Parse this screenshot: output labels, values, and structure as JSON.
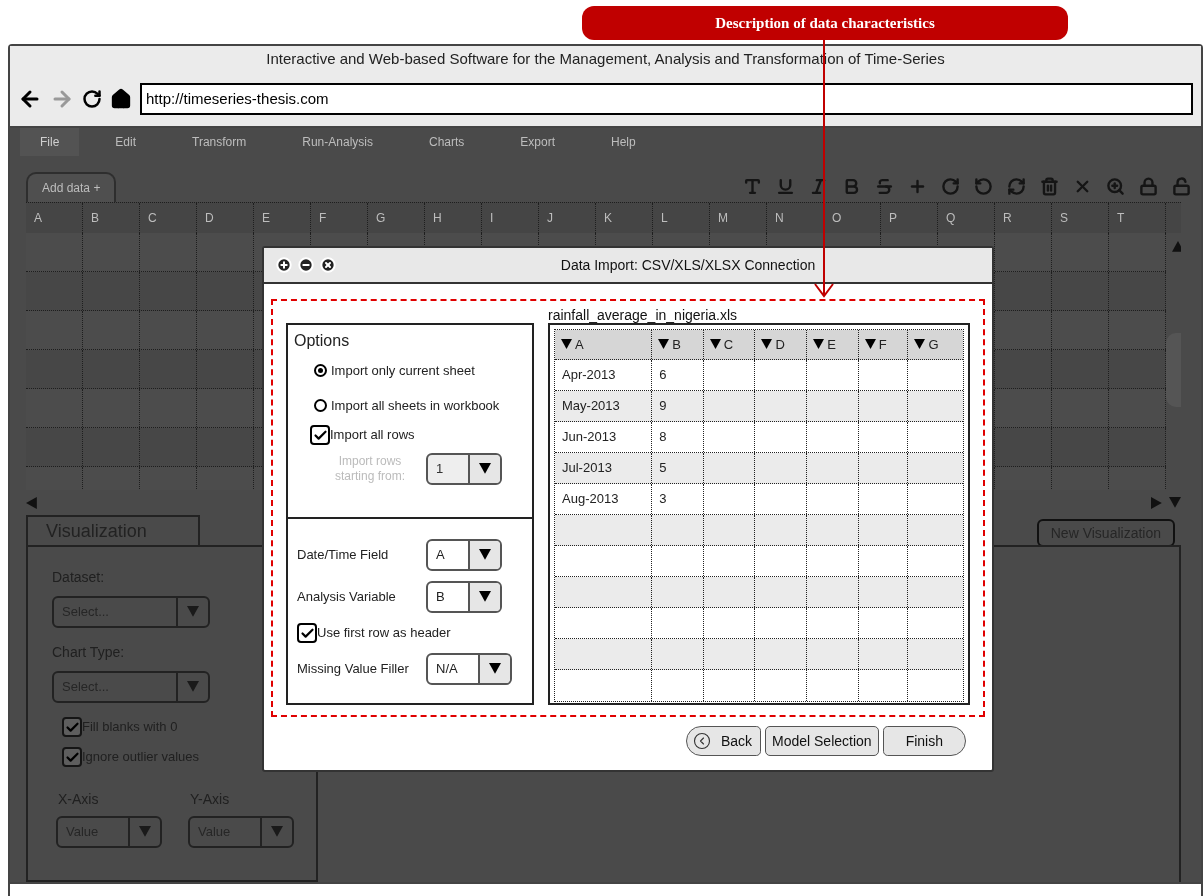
{
  "callout": {
    "text": "Description of data characteristics"
  },
  "browser": {
    "title": "Interactive and Web-based Software for the Management, Analysis and Transformation of Time-Series",
    "url": "http://timeseries-thesis.com"
  },
  "menu": [
    {
      "label": "File",
      "selected": true
    },
    {
      "label": "Edit",
      "selected": false
    },
    {
      "label": "Transform",
      "selected": false
    },
    {
      "label": "Run-Analysis",
      "selected": false
    },
    {
      "label": "Charts",
      "selected": false
    },
    {
      "label": "Export",
      "selected": false
    },
    {
      "label": "Help",
      "selected": false
    }
  ],
  "sheet_tab": {
    "label": "Add data +"
  },
  "spreadsheet": {
    "columns": [
      "A",
      "B",
      "C",
      "D",
      "E",
      "F",
      "G",
      "H",
      "I",
      "J",
      "K",
      "L",
      "M",
      "N",
      "O",
      "P",
      "Q",
      "R",
      "S",
      "T"
    ]
  },
  "visualization": {
    "tab": "Visualization",
    "dataset_label": "Dataset:",
    "dataset_value": "Select...",
    "chart_type_label": "Chart Type:",
    "chart_type_value": "Select...",
    "options": [
      {
        "label": "Fill blanks with 0",
        "checked": true
      },
      {
        "label": "Ignore outlier values",
        "checked": true
      }
    ],
    "x_axis": {
      "label": "X-Axis",
      "value": "Value"
    },
    "y_axis": {
      "label": "Y-Axis",
      "value": "Value"
    },
    "new_button": "New Visualization"
  },
  "dialog": {
    "title": "Data Import: CSV/XLS/XLSX Connection",
    "options_title": "Options",
    "sheet_options": [
      {
        "label": "Import only current sheet",
        "selected": true
      },
      {
        "label": "Import all sheets in workbook",
        "selected": false
      }
    ],
    "import_all_rows": {
      "label": "Import all rows",
      "checked": true
    },
    "start_row": {
      "label": "Import rows starting from:",
      "value": "1",
      "disabled": true
    },
    "fields": [
      {
        "label": "Date/Time Field",
        "value": "A"
      },
      {
        "label": "Analysis Variable",
        "value": "B"
      }
    ],
    "header_row": {
      "label": "Use first row as header",
      "checked": true
    },
    "missing_filler": {
      "label": "Missing Value Filler",
      "value": "N/A"
    },
    "file_name": "rainfall_average_in_nigeria.xls",
    "table": {
      "columns": [
        "A",
        "B",
        "C",
        "D",
        "E",
        "F",
        "G"
      ],
      "rows": [
        [
          "Apr-2013",
          "6"
        ],
        [
          "May-2013",
          "9"
        ],
        [
          "Jun-2013",
          "8"
        ],
        [
          "Jul-2013",
          "5"
        ],
        [
          "Aug-2013",
          "3"
        ]
      ]
    },
    "buttons": [
      {
        "kind": "back",
        "label": "Back"
      },
      {
        "kind": "plain",
        "label": "Model Selection"
      },
      {
        "kind": "next",
        "label": "Finish"
      }
    ]
  }
}
